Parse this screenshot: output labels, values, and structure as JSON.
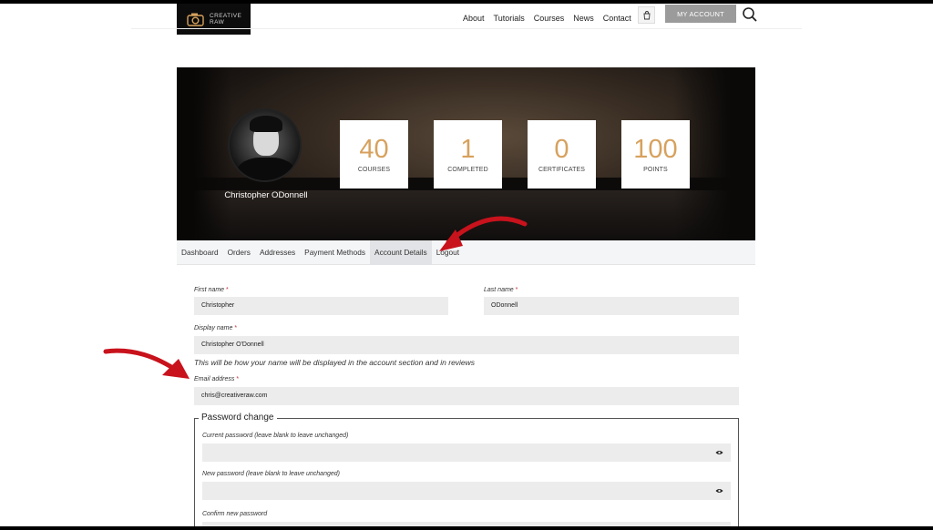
{
  "logo": {
    "line1": "CREATIVE",
    "line2": "RAW"
  },
  "nav": [
    "About",
    "Tutorials",
    "Courses",
    "News",
    "Contact"
  ],
  "account_button": "MY ACCOUNT",
  "profile": {
    "name": "Christopher ODonnell"
  },
  "stats": [
    {
      "value": "40",
      "label": "COURSES"
    },
    {
      "value": "1",
      "label": "COMPLETED"
    },
    {
      "value": "0",
      "label": "CERTIFICATES"
    },
    {
      "value": "100",
      "label": "POINTS"
    }
  ],
  "tabs": [
    "Dashboard",
    "Orders",
    "Addresses",
    "Payment Methods",
    "Account Details",
    "Logout"
  ],
  "active_tab": "Account Details",
  "form": {
    "first_name_label": "First name",
    "first_name_value": "Christopher",
    "last_name_label": "Last name",
    "last_name_value": "ODonnell",
    "display_name_label": "Display name",
    "display_name_value": "Christopher O'Donnell",
    "display_hint": "This will be how your name will be displayed in the account section and in reviews",
    "email_label": "Email address",
    "email_value": "chris@creativeraw.com",
    "required_marker": "*"
  },
  "password": {
    "legend": "Password change",
    "current_label": "Current password (leave blank to leave unchanged)",
    "new_label": "New password (leave blank to leave unchanged)",
    "confirm_label": "Confirm new password"
  },
  "colors": {
    "accent": "#d7a15d",
    "required": "#c8323a",
    "annotation": "#c8121c",
    "button": "#9b9b9b"
  }
}
